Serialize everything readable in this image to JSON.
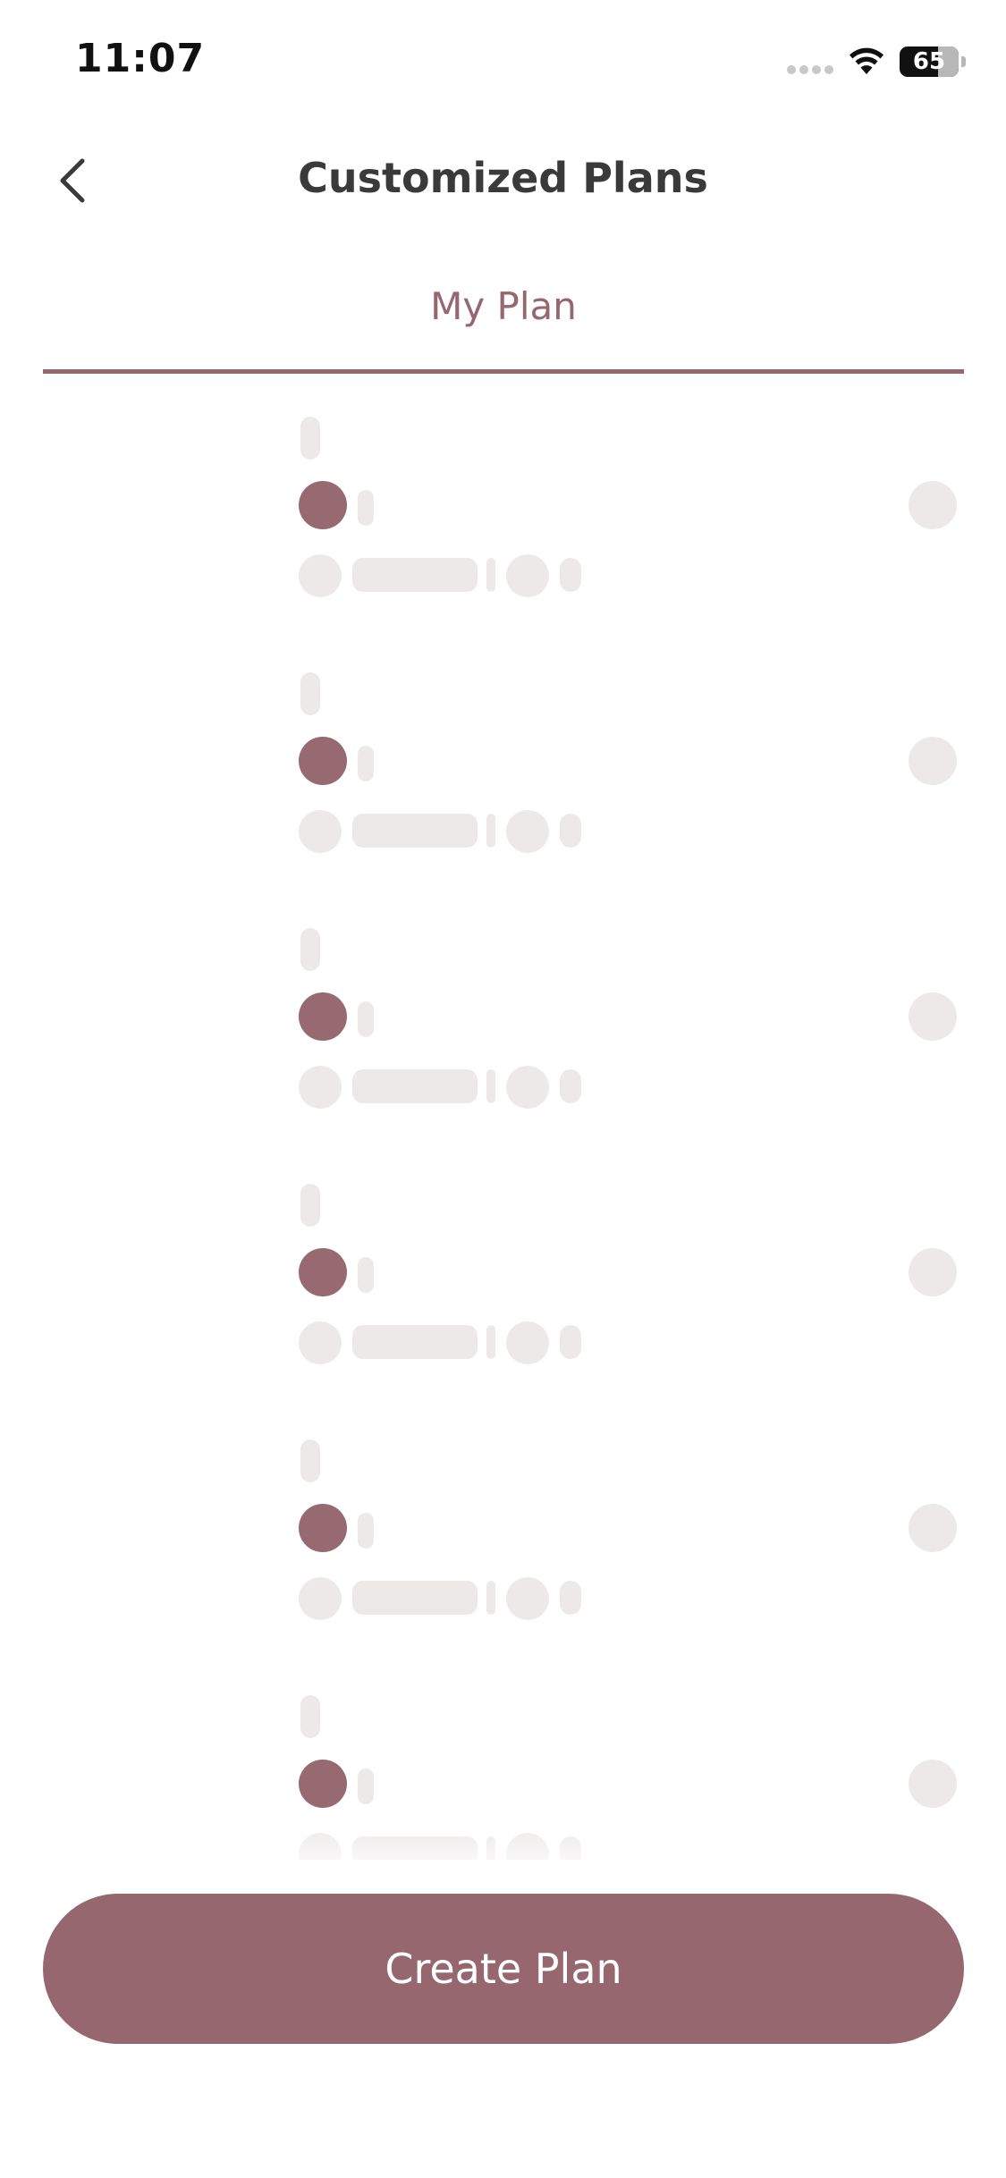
{
  "status_bar": {
    "time": "11:07",
    "battery_level": "65",
    "battery_percent": 65,
    "icons": [
      "cellular-signal-icon",
      "wifi-icon",
      "battery-icon"
    ]
  },
  "header": {
    "back_icon": "chevron-left-icon",
    "title": "Customized Plans"
  },
  "tabs": [
    {
      "label": "My Plan",
      "selected": true
    }
  ],
  "plan_list": {
    "loading": true,
    "skeleton_count": 6
  },
  "actions": {
    "create_plan_label": "Create Plan"
  },
  "colors": {
    "accent": "#96676f",
    "skeleton": "#ede9e9",
    "title_text": "#3a3a3a",
    "background": "#ffffff"
  }
}
